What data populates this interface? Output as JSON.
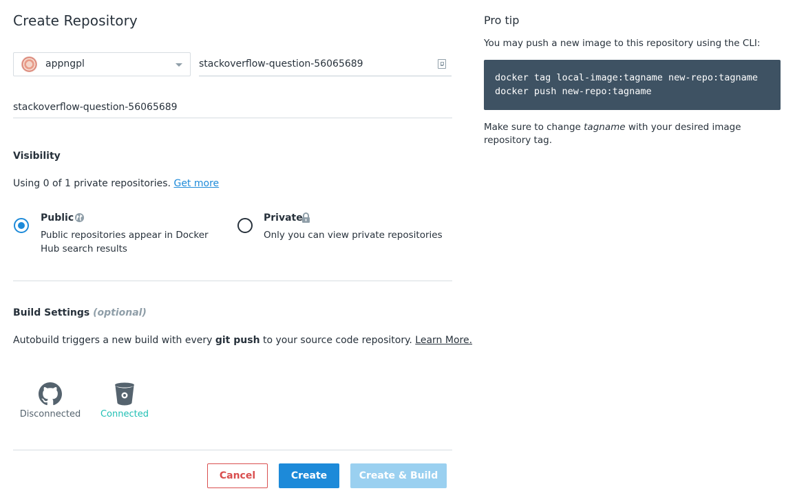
{
  "page": {
    "title": "Create Repository"
  },
  "namespace": {
    "selected": "appngpl"
  },
  "repo_name": {
    "value": "stackoverflow-question-56065689"
  },
  "description": {
    "value": "stackoverflow-question-56065689"
  },
  "visibility": {
    "heading": "Visibility",
    "usage_text": "Using 0 of 1 private repositories.",
    "get_more_link": "Get more",
    "public": {
      "title": "Public",
      "desc": "Public repositories appear in Docker Hub search results",
      "icon": "globe-icon",
      "selected": true
    },
    "private": {
      "title": "Private",
      "desc": "Only you can view private repositories",
      "icon": "lock-icon",
      "selected": false
    }
  },
  "build": {
    "heading": "Build Settings",
    "optional": "(optional)",
    "text_before": "Autobuild triggers a new build with every",
    "text_bold": "git push",
    "text_after": "to your source code repository.",
    "learn_more": "Learn More.",
    "providers": [
      {
        "icon": "github-icon",
        "status": "Disconnected"
      },
      {
        "icon": "bitbucket-icon",
        "status": "Connected"
      }
    ]
  },
  "actions": {
    "cancel": "Cancel",
    "create": "Create",
    "create_build": "Create & Build"
  },
  "tip": {
    "title": "Pro tip",
    "text": "You may push a new image to this repository using the CLI:",
    "code": [
      "docker tag local-image:tagname new-repo:tagname",
      "docker push new-repo:tagname"
    ],
    "note_before": "Make sure to change",
    "note_em": "tagname",
    "note_after": "with your desired image repository tag."
  },
  "colors": {
    "accent": "#1d8ad9",
    "danger": "#d94e4e",
    "connected": "#1fbfb4",
    "code_bg": "#3e5263"
  }
}
